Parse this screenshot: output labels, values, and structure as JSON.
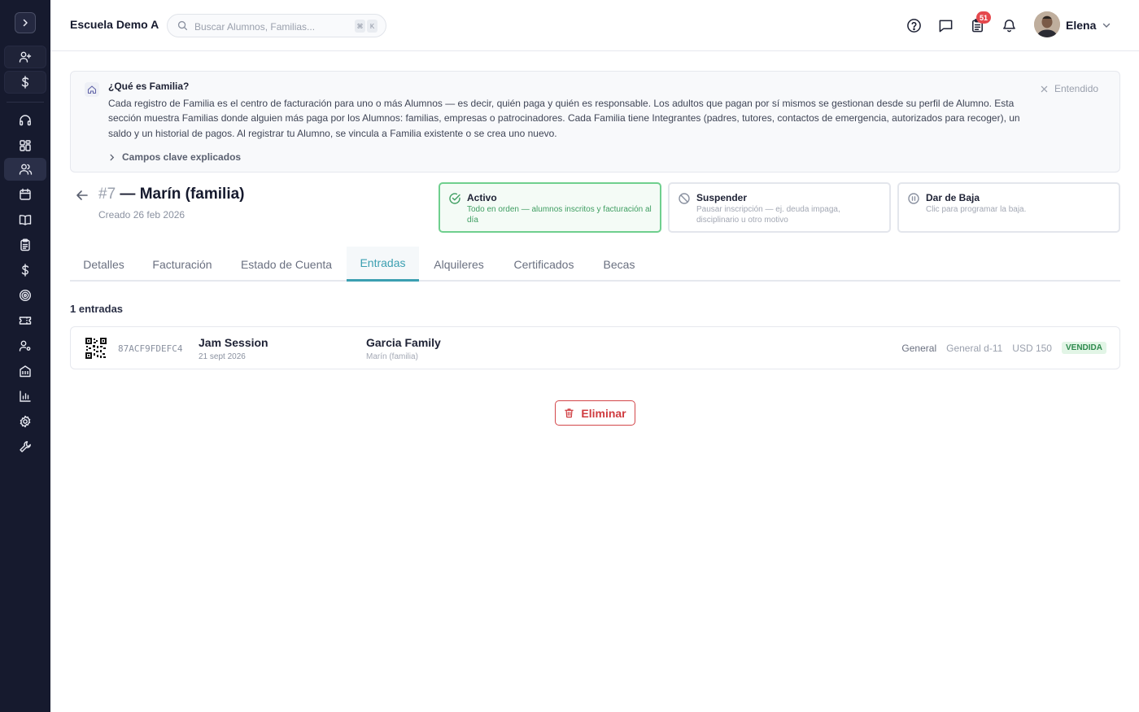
{
  "colors": {
    "sidebar": "#161a2e",
    "accent": "#3b9fb1",
    "active_green": "#6fcf8e",
    "danger": "#cf3b3f",
    "badge": "#e5484d"
  },
  "sidebar": {
    "items": [
      {
        "icon": "add-user-icon"
      },
      {
        "icon": "dollar-icon"
      },
      {
        "icon": "headset-icon"
      },
      {
        "icon": "dashboard-icon"
      },
      {
        "icon": "users-icon",
        "active": true
      },
      {
        "icon": "calendar-icon"
      },
      {
        "icon": "book-icon"
      },
      {
        "icon": "clipboard-icon"
      },
      {
        "icon": "dollar-icon"
      },
      {
        "icon": "target-icon"
      },
      {
        "icon": "ticket-icon"
      },
      {
        "icon": "user-settings-icon"
      },
      {
        "icon": "building-icon"
      },
      {
        "icon": "bar-chart-icon"
      },
      {
        "icon": "gear-icon"
      },
      {
        "icon": "wrench-icon"
      }
    ]
  },
  "header": {
    "school_name": "Escuela Demo A",
    "search_placeholder": "Buscar Alumnos, Familias...",
    "shortcut_keys": [
      "⌘",
      "K"
    ],
    "notification_count": "51",
    "user_name": "Elena"
  },
  "info_banner": {
    "title": "¿Qué es Familia?",
    "body": "Cada registro de Familia es el centro de facturación para uno o más Alumnos — es decir, quién paga y quién es responsable. Los adultos que pagan por sí mismos se gestionan desde su perfil de Alumno. Esta sección muestra Familias donde alguien más paga por los Alumnos: familias, empresas o patrocinadores. Cada Familia tiene Integrantes (padres, tutores, contactos de emergencia, autorizados para recoger), un saldo y un historial de pagos. Al registrar tu Alumno, se vincula a Familia existente o se crea uno nuevo.",
    "dismiss_label": "Entendido",
    "expand_label": "Campos clave explicados"
  },
  "family": {
    "number": "#7",
    "name": "— Marín (familia)",
    "created": "Creado 26 feb 2026"
  },
  "status_options": [
    {
      "title": "Activo",
      "desc": "Todo en orden — alumnos inscritos y facturación al día",
      "selected": true,
      "icon": "check-circle-icon"
    },
    {
      "title": "Suspender",
      "desc": "Pausar inscripción — ej. deuda impaga, disciplinario u otro motivo",
      "selected": false,
      "icon": "ban-icon"
    },
    {
      "title": "Dar de Baja",
      "desc": "Clic para programar la baja.",
      "selected": false,
      "icon": "pause-circle-icon"
    }
  ],
  "tabs": [
    "Detalles",
    "Facturación",
    "Estado de Cuenta",
    "Entradas",
    "Alquileres",
    "Certificados",
    "Becas"
  ],
  "active_tab": "Entradas",
  "entries": {
    "count_label": "1 entradas",
    "items": [
      {
        "code": "87ACF9FDEFC4",
        "event": "Jam Session",
        "date": "21 sept 2026",
        "holder": "Garcia Family",
        "holder_sub": "Marín (familia)",
        "tier": "General",
        "seat": "General d-11",
        "price": "USD 150",
        "status": "VENDIDA"
      }
    ]
  },
  "delete_label": "Eliminar"
}
